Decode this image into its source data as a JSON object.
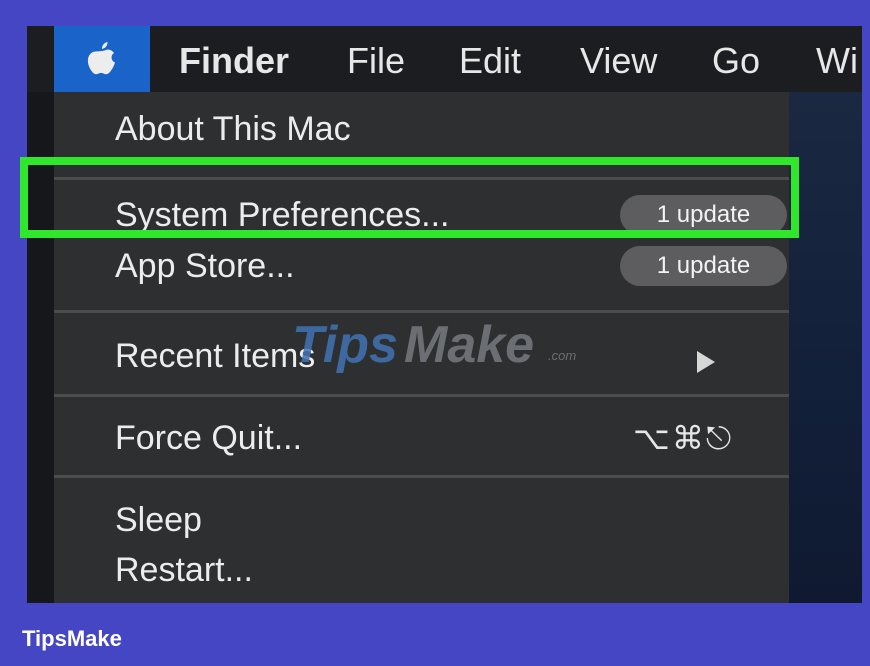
{
  "menubar": {
    "apple_icon": "apple-logo-icon",
    "items": [
      "Finder",
      "File",
      "Edit",
      "View",
      "Go",
      "Wi"
    ]
  },
  "apple_menu": {
    "about": "About This Mac",
    "system_preferences": {
      "label": "System Preferences...",
      "badge": "1 update"
    },
    "app_store": {
      "label": "App Store...",
      "badge": "1 update"
    },
    "recent_items": {
      "label": "Recent Items",
      "submenu_icon": "submenu-arrow-icon"
    },
    "force_quit": {
      "label": "Force Quit...",
      "shortcut": "⌥⌘⎋"
    },
    "sleep": "Sleep",
    "restart": "Restart..."
  },
  "watermark": {
    "part1": "Tips",
    "part2": "Make",
    "part3": ".com"
  },
  "footer": {
    "brand": "TipsMake"
  },
  "colors": {
    "frame": "#4446c4",
    "menu_bg": "#2e2f31",
    "apple_highlight": "#1a63c9",
    "highlight_box": "#2fe82b",
    "badge_bg": "#5d5d5f"
  }
}
